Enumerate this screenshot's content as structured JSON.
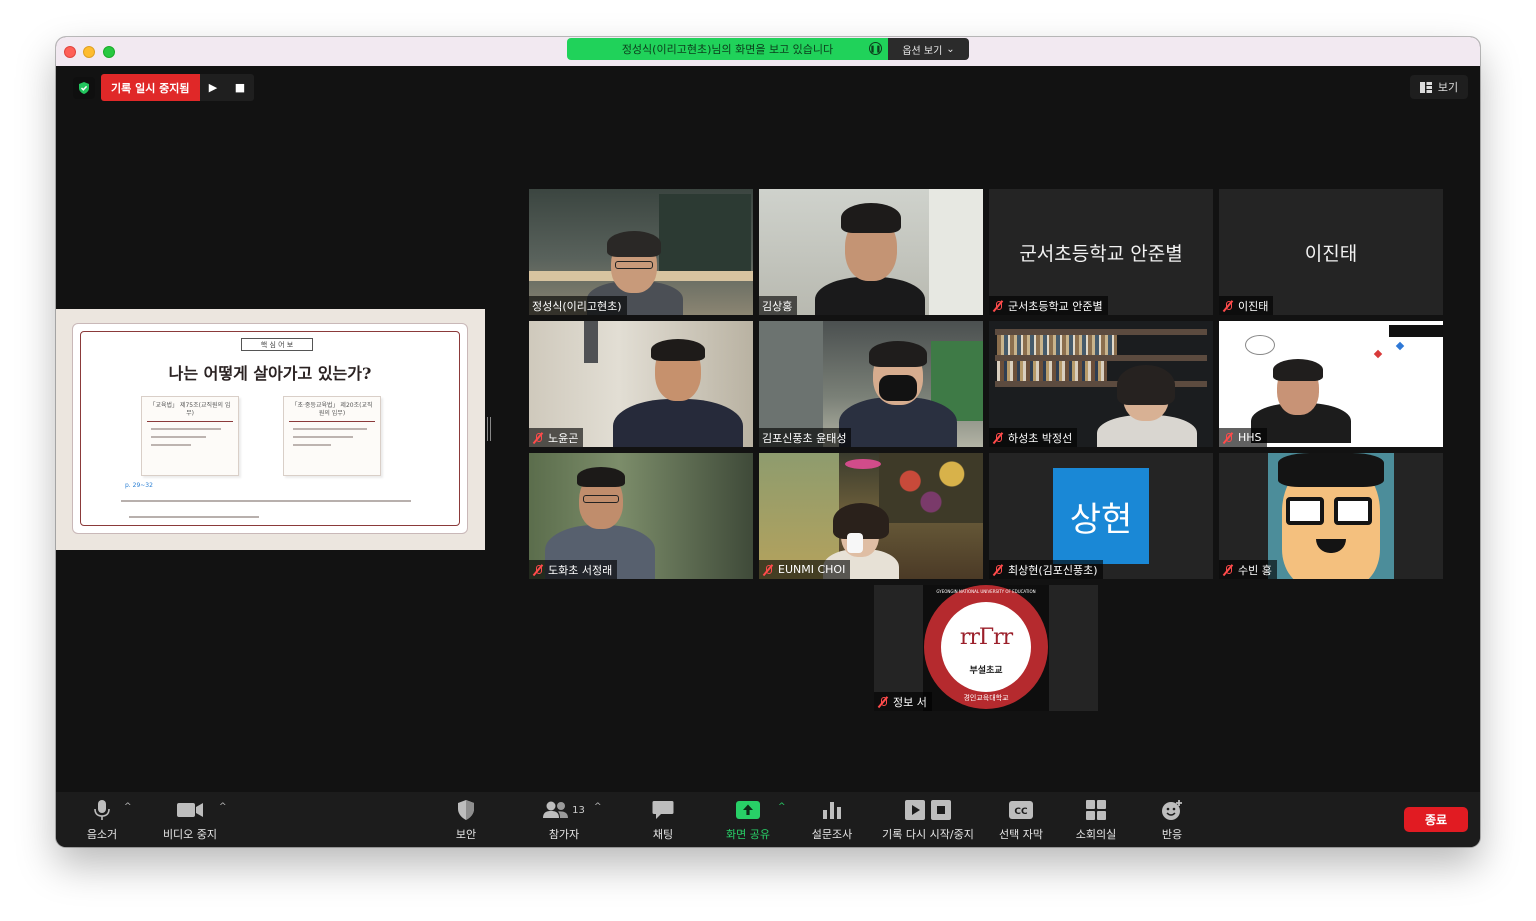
{
  "window": {
    "share_banner": "정성식(이리고현초)님의 화면을 보고 있습니다",
    "view_options": "옵션 보기"
  },
  "recording": {
    "status": "기록 일시 중지됨"
  },
  "view": {
    "label": "보기"
  },
  "shared_slide": {
    "tag": "핵    심    어    보",
    "title": "나는 어떻게 살아가고 있는가?",
    "note1_head": "「교육법」 제75조(교직원의 임무)",
    "note2_head": "「초·중등교육법」 제20조(교직원의 임무)",
    "page_ref": "p. 29~32"
  },
  "participants": [
    {
      "name": "정성식(이리고현초)",
      "muted": false,
      "active": true
    },
    {
      "name": "김상홍",
      "muted": false
    },
    {
      "name": "군서초등학교 안준별",
      "muted": true,
      "display": "군서초등학교 안준별"
    },
    {
      "name": "이진태",
      "muted": true,
      "display": "이진태"
    },
    {
      "name": "노윤곤",
      "muted": true
    },
    {
      "name": "김포신풍초 윤태성",
      "muted": false
    },
    {
      "name": "하성초 박정선",
      "muted": true
    },
    {
      "name": "HHS",
      "muted": true
    },
    {
      "name": "도화초 서정래",
      "muted": true
    },
    {
      "name": "EUNMI CHOI",
      "muted": true
    },
    {
      "name": "최상현(김포신풍초)",
      "muted": true,
      "avatar_text": "상현"
    },
    {
      "name": "수빈 홍",
      "muted": true
    },
    {
      "name": "정보 서",
      "muted": true,
      "logo_text": "부설초교",
      "logo_ring": "GYEONGIN NATIONAL UNIVERSITY OF EDUCATION",
      "logo_bottom": "경인교육대학교"
    }
  ],
  "toolbar": {
    "mute": "음소거",
    "video": "비디오 중지",
    "security": "보안",
    "participants": "참가자",
    "participants_count": "13",
    "chat": "채팅",
    "share": "화면 공유",
    "polls": "설문조사",
    "record": "기록 다시 시작/중지",
    "captions": "선택 자막",
    "breakout": "소회의실",
    "reactions": "반응",
    "end": "종료"
  },
  "colors": {
    "share_green": "#20d25a",
    "record_red": "#e02828",
    "active_speaker": "#c7e878",
    "end_red": "#e11b22",
    "avatar_blue": "#1a88d6"
  }
}
